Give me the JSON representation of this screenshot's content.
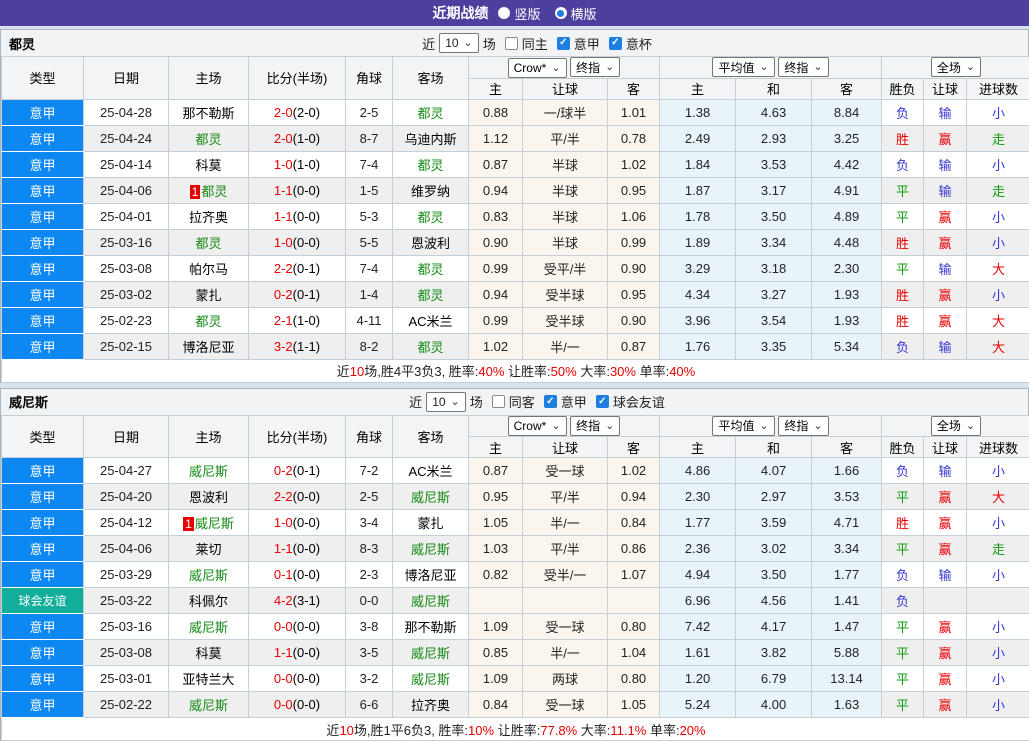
{
  "title_bar": {
    "title": "近期战绩",
    "radios": [
      {
        "label": "竖版",
        "checked": false
      },
      {
        "label": "横版",
        "checked": true
      }
    ]
  },
  "filter_labels": {
    "near": "近",
    "games": "场"
  },
  "columns": {
    "basic": [
      "类型",
      "日期",
      "主场",
      "比分(半场)",
      "角球",
      "客场"
    ],
    "sub": [
      "主",
      "让球",
      "客",
      "主",
      "和",
      "客",
      "胜负",
      "让球",
      "进球数"
    ],
    "selects": {
      "bookmaker": "Crow*",
      "final1": "终指",
      "average": "平均值",
      "final2": "终指",
      "scope": "全场"
    }
  },
  "tables": [
    {
      "team": "都灵",
      "count": "10",
      "checkboxes": [
        {
          "label": "同主",
          "checked": false
        },
        {
          "label": "意甲",
          "checked": true
        },
        {
          "label": "意杯",
          "checked": true
        }
      ],
      "rows": [
        {
          "type": "意甲",
          "friendly": false,
          "date": "25-04-28",
          "home": "那不勒斯",
          "home_focus": false,
          "badge": "",
          "score": "2-0",
          "half": "(2-0)",
          "corner": "2-5",
          "away": "都灵",
          "away_focus": true,
          "odds": [
            "0.88",
            "一/球半",
            "1.01"
          ],
          "avg": [
            "1.38",
            "4.63",
            "8.84"
          ],
          "results": [
            [
              "负",
              "b"
            ],
            [
              "输",
              "b"
            ],
            [
              "小",
              "b"
            ]
          ]
        },
        {
          "type": "意甲",
          "friendly": false,
          "date": "25-04-24",
          "home": "都灵",
          "home_focus": true,
          "badge": "",
          "score": "2-0",
          "half": "(1-0)",
          "corner": "8-7",
          "away": "乌迪内斯",
          "away_focus": false,
          "odds": [
            "1.12",
            "平/半",
            "0.78"
          ],
          "avg": [
            "2.49",
            "2.93",
            "3.25"
          ],
          "results": [
            [
              "胜",
              "r"
            ],
            [
              "赢",
              "r"
            ],
            [
              "走",
              "g"
            ]
          ]
        },
        {
          "type": "意甲",
          "friendly": false,
          "date": "25-04-14",
          "home": "科莫",
          "home_focus": false,
          "badge": "",
          "score": "1-0",
          "half": "(1-0)",
          "corner": "7-4",
          "away": "都灵",
          "away_focus": true,
          "odds": [
            "0.87",
            "半球",
            "1.02"
          ],
          "avg": [
            "1.84",
            "3.53",
            "4.42"
          ],
          "results": [
            [
              "负",
              "b"
            ],
            [
              "输",
              "b"
            ],
            [
              "小",
              "b"
            ]
          ]
        },
        {
          "type": "意甲",
          "friendly": false,
          "date": "25-04-06",
          "home": "都灵",
          "home_focus": true,
          "badge": "1",
          "score": "1-1",
          "half": "(0-0)",
          "corner": "1-5",
          "away": "维罗纳",
          "away_focus": false,
          "odds": [
            "0.94",
            "半球",
            "0.95"
          ],
          "avg": [
            "1.87",
            "3.17",
            "4.91"
          ],
          "results": [
            [
              "平",
              "g"
            ],
            [
              "输",
              "b"
            ],
            [
              "走",
              "g"
            ]
          ]
        },
        {
          "type": "意甲",
          "friendly": false,
          "date": "25-04-01",
          "home": "拉齐奥",
          "home_focus": false,
          "badge": "",
          "score": "1-1",
          "half": "(0-0)",
          "corner": "5-3",
          "away": "都灵",
          "away_focus": true,
          "odds": [
            "0.83",
            "半球",
            "1.06"
          ],
          "avg": [
            "1.78",
            "3.50",
            "4.89"
          ],
          "results": [
            [
              "平",
              "g"
            ],
            [
              "赢",
              "r"
            ],
            [
              "小",
              "b"
            ]
          ]
        },
        {
          "type": "意甲",
          "friendly": false,
          "date": "25-03-16",
          "home": "都灵",
          "home_focus": true,
          "badge": "",
          "score": "1-0",
          "half": "(0-0)",
          "corner": "5-5",
          "away": "恩波利",
          "away_focus": false,
          "odds": [
            "0.90",
            "半球",
            "0.99"
          ],
          "avg": [
            "1.89",
            "3.34",
            "4.48"
          ],
          "results": [
            [
              "胜",
              "r"
            ],
            [
              "赢",
              "r"
            ],
            [
              "小",
              "b"
            ]
          ]
        },
        {
          "type": "意甲",
          "friendly": false,
          "date": "25-03-08",
          "home": "帕尔马",
          "home_focus": false,
          "badge": "",
          "score": "2-2",
          "half": "(0-1)",
          "corner": "7-4",
          "away": "都灵",
          "away_focus": true,
          "odds": [
            "0.99",
            "受平/半",
            "0.90"
          ],
          "avg": [
            "3.29",
            "3.18",
            "2.30"
          ],
          "results": [
            [
              "平",
              "g"
            ],
            [
              "输",
              "b"
            ],
            [
              "大",
              "r"
            ]
          ]
        },
        {
          "type": "意甲",
          "friendly": false,
          "date": "25-03-02",
          "home": "蒙扎",
          "home_focus": false,
          "badge": "",
          "score": "0-2",
          "half": "(0-1)",
          "corner": "1-4",
          "away": "都灵",
          "away_focus": true,
          "odds": [
            "0.94",
            "受半球",
            "0.95"
          ],
          "avg": [
            "4.34",
            "3.27",
            "1.93"
          ],
          "results": [
            [
              "胜",
              "r"
            ],
            [
              "赢",
              "r"
            ],
            [
              "小",
              "b"
            ]
          ]
        },
        {
          "type": "意甲",
          "friendly": false,
          "date": "25-02-23",
          "home": "都灵",
          "home_focus": true,
          "badge": "",
          "score": "2-1",
          "half": "(1-0)",
          "corner": "4-11",
          "away": "AC米兰",
          "away_focus": false,
          "odds": [
            "0.99",
            "受半球",
            "0.90"
          ],
          "avg": [
            "3.96",
            "3.54",
            "1.93"
          ],
          "results": [
            [
              "胜",
              "r"
            ],
            [
              "赢",
              "r"
            ],
            [
              "大",
              "r"
            ]
          ]
        },
        {
          "type": "意甲",
          "friendly": false,
          "date": "25-02-15",
          "home": "博洛尼亚",
          "home_focus": false,
          "badge": "",
          "score": "3-2",
          "half": "(1-1)",
          "corner": "8-2",
          "away": "都灵",
          "away_focus": true,
          "odds": [
            "1.02",
            "半/一",
            "0.87"
          ],
          "avg": [
            "1.76",
            "3.35",
            "5.34"
          ],
          "results": [
            [
              "负",
              "b"
            ],
            [
              "输",
              "b"
            ],
            [
              "大",
              "r"
            ]
          ]
        }
      ],
      "summary": [
        [
          "近",
          "k"
        ],
        [
          "10",
          "r"
        ],
        [
          "场,胜4平3负3, 胜率:",
          "k"
        ],
        [
          "40%",
          "r"
        ],
        [
          " 让胜率:",
          "k"
        ],
        [
          "50%",
          "r"
        ],
        [
          " 大率:",
          "k"
        ],
        [
          "30%",
          "r"
        ],
        [
          " 单率:",
          "k"
        ],
        [
          "40%",
          "r"
        ]
      ]
    },
    {
      "team": "威尼斯",
      "count": "10",
      "checkboxes": [
        {
          "label": "同客",
          "checked": false
        },
        {
          "label": "意甲",
          "checked": true
        },
        {
          "label": "球会友谊",
          "checked": true
        }
      ],
      "rows": [
        {
          "type": "意甲",
          "friendly": false,
          "date": "25-04-27",
          "home": "威尼斯",
          "home_focus": true,
          "badge": "",
          "score": "0-2",
          "half": "(0-1)",
          "corner": "7-2",
          "away": "AC米兰",
          "away_focus": false,
          "odds": [
            "0.87",
            "受一球",
            "1.02"
          ],
          "avg": [
            "4.86",
            "4.07",
            "1.66"
          ],
          "results": [
            [
              "负",
              "b"
            ],
            [
              "输",
              "b"
            ],
            [
              "小",
              "b"
            ]
          ]
        },
        {
          "type": "意甲",
          "friendly": false,
          "date": "25-04-20",
          "home": "恩波利",
          "home_focus": false,
          "badge": "",
          "score": "2-2",
          "half": "(0-0)",
          "corner": "2-5",
          "away": "威尼斯",
          "away_focus": true,
          "odds": [
            "0.95",
            "平/半",
            "0.94"
          ],
          "avg": [
            "2.30",
            "2.97",
            "3.53"
          ],
          "results": [
            [
              "平",
              "g"
            ],
            [
              "赢",
              "r"
            ],
            [
              "大",
              "r"
            ]
          ]
        },
        {
          "type": "意甲",
          "friendly": false,
          "date": "25-04-12",
          "home": "威尼斯",
          "home_focus": true,
          "badge": "1",
          "score": "1-0",
          "half": "(0-0)",
          "corner": "3-4",
          "away": "蒙扎",
          "away_focus": false,
          "odds": [
            "1.05",
            "半/一",
            "0.84"
          ],
          "avg": [
            "1.77",
            "3.59",
            "4.71"
          ],
          "results": [
            [
              "胜",
              "r"
            ],
            [
              "赢",
              "r"
            ],
            [
              "小",
              "b"
            ]
          ]
        },
        {
          "type": "意甲",
          "friendly": false,
          "date": "25-04-06",
          "home": "莱切",
          "home_focus": false,
          "badge": "",
          "score": "1-1",
          "half": "(0-0)",
          "corner": "8-3",
          "away": "威尼斯",
          "away_focus": true,
          "odds": [
            "1.03",
            "平/半",
            "0.86"
          ],
          "avg": [
            "2.36",
            "3.02",
            "3.34"
          ],
          "results": [
            [
              "平",
              "g"
            ],
            [
              "赢",
              "r"
            ],
            [
              "走",
              "g"
            ]
          ]
        },
        {
          "type": "意甲",
          "friendly": false,
          "date": "25-03-29",
          "home": "威尼斯",
          "home_focus": true,
          "badge": "",
          "score": "0-1",
          "half": "(0-0)",
          "corner": "2-3",
          "away": "博洛尼亚",
          "away_focus": false,
          "odds": [
            "0.82",
            "受半/一",
            "1.07"
          ],
          "avg": [
            "4.94",
            "3.50",
            "1.77"
          ],
          "results": [
            [
              "负",
              "b"
            ],
            [
              "输",
              "b"
            ],
            [
              "小",
              "b"
            ]
          ]
        },
        {
          "type": "球会友谊",
          "friendly": true,
          "date": "25-03-22",
          "home": "科佩尔",
          "home_focus": false,
          "badge": "",
          "score": "4-2",
          "half": "(3-1)",
          "corner": "0-0",
          "away": "威尼斯",
          "away_focus": true,
          "odds": [
            "",
            "",
            ""
          ],
          "avg": [
            "6.96",
            "4.56",
            "1.41"
          ],
          "results": [
            [
              "负",
              "b"
            ],
            [
              "",
              ""
            ],
            [
              "",
              ""
            ]
          ]
        },
        {
          "type": "意甲",
          "friendly": false,
          "date": "25-03-16",
          "home": "威尼斯",
          "home_focus": true,
          "badge": "",
          "score": "0-0",
          "half": "(0-0)",
          "corner": "3-8",
          "away": "那不勒斯",
          "away_focus": false,
          "odds": [
            "1.09",
            "受一球",
            "0.80"
          ],
          "avg": [
            "7.42",
            "4.17",
            "1.47"
          ],
          "results": [
            [
              "平",
              "g"
            ],
            [
              "赢",
              "r"
            ],
            [
              "小",
              "b"
            ]
          ]
        },
        {
          "type": "意甲",
          "friendly": false,
          "date": "25-03-08",
          "home": "科莫",
          "home_focus": false,
          "badge": "",
          "score": "1-1",
          "half": "(0-0)",
          "corner": "3-5",
          "away": "威尼斯",
          "away_focus": true,
          "odds": [
            "0.85",
            "半/一",
            "1.04"
          ],
          "avg": [
            "1.61",
            "3.82",
            "5.88"
          ],
          "results": [
            [
              "平",
              "g"
            ],
            [
              "赢",
              "r"
            ],
            [
              "小",
              "b"
            ]
          ]
        },
        {
          "type": "意甲",
          "friendly": false,
          "date": "25-03-01",
          "home": "亚特兰大",
          "home_focus": false,
          "badge": "",
          "score": "0-0",
          "half": "(0-0)",
          "corner": "3-2",
          "away": "威尼斯",
          "away_focus": true,
          "odds": [
            "1.09",
            "两球",
            "0.80"
          ],
          "avg": [
            "1.20",
            "6.79",
            "13.14"
          ],
          "results": [
            [
              "平",
              "g"
            ],
            [
              "赢",
              "r"
            ],
            [
              "小",
              "b"
            ]
          ]
        },
        {
          "type": "意甲",
          "friendly": false,
          "date": "25-02-22",
          "home": "威尼斯",
          "home_focus": true,
          "badge": "",
          "score": "0-0",
          "half": "(0-0)",
          "corner": "6-6",
          "away": "拉齐奥",
          "away_focus": false,
          "odds": [
            "0.84",
            "受一球",
            "1.05"
          ],
          "avg": [
            "5.24",
            "4.00",
            "1.63"
          ],
          "results": [
            [
              "平",
              "g"
            ],
            [
              "赢",
              "r"
            ],
            [
              "小",
              "b"
            ]
          ]
        }
      ],
      "summary": [
        [
          "近",
          "k"
        ],
        [
          "10",
          "r"
        ],
        [
          "场,胜1平6负3, 胜率:",
          "k"
        ],
        [
          "10%",
          "r"
        ],
        [
          " 让胜率:",
          "k"
        ],
        [
          "77.8%",
          "r"
        ],
        [
          " 大率:",
          "k"
        ],
        [
          "11.1%",
          "r"
        ],
        [
          " 单率:",
          "k"
        ],
        [
          "20%",
          "r"
        ]
      ]
    }
  ]
}
